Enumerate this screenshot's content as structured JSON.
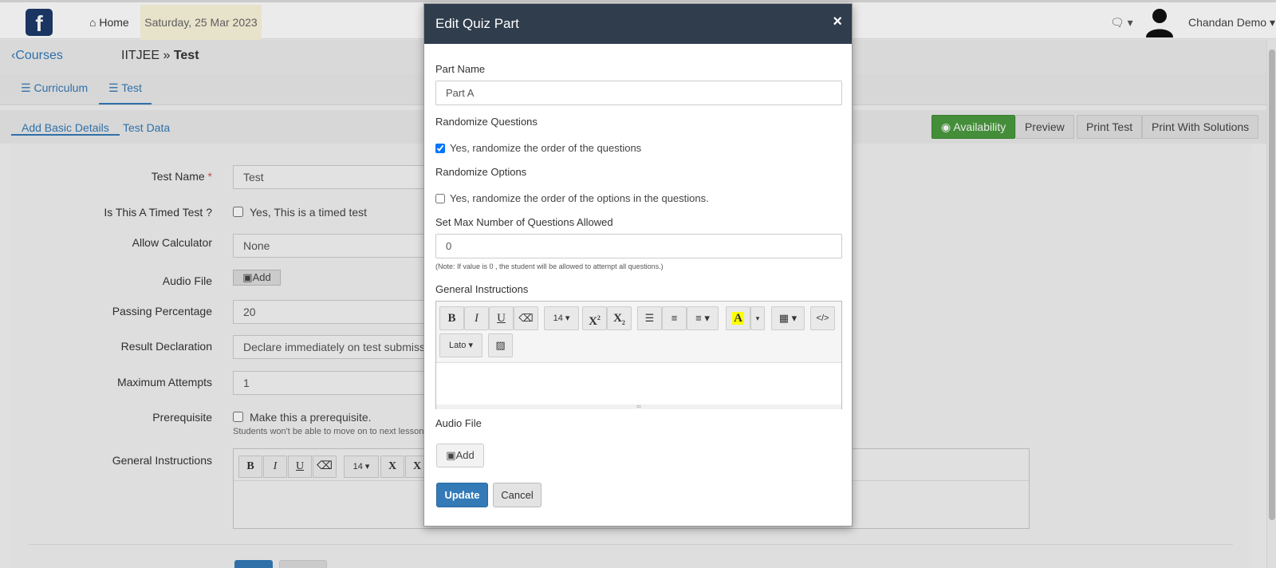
{
  "topbar": {
    "logo_letter": "f",
    "home_label": "Home",
    "date": "Saturday, 25 Mar 2023",
    "user_name": "Chandan Demo"
  },
  "breadcrumb": {
    "back_label": "Courses",
    "course": "IITJEE",
    "separator": " » ",
    "current": "Test"
  },
  "tabs": [
    {
      "label": "Curriculum",
      "active": false
    },
    {
      "label": "Test",
      "active": true
    }
  ],
  "subtabs": [
    {
      "label": "Add Basic Details",
      "active": true
    },
    {
      "label": "Test Data",
      "active": false
    }
  ],
  "actions": {
    "availability": "Availability",
    "preview": "Preview",
    "print_test": "Print Test",
    "print_solutions": "Print With Solutions"
  },
  "form": {
    "test_name_label": "Test Name",
    "test_name_value": "Test",
    "timed_label": "Is This A Timed Test ?",
    "timed_check": "Yes, This is a timed test",
    "calculator_label": "Allow Calculator",
    "calculator_value": "None",
    "audio_label": "Audio File",
    "audio_add": "Add",
    "passing_label": "Passing Percentage",
    "passing_value": "20",
    "result_label": "Result Declaration",
    "result_value": "Declare immediately on test submission",
    "attempts_label": "Maximum Attempts",
    "attempts_value": "1",
    "prereq_label": "Prerequisite",
    "prereq_check": "Make this a prerequisite.",
    "prereq_note": "Students won't be able to move on to next lessons u",
    "instructions_label": "General Instructions",
    "editor_size": "14"
  },
  "modal": {
    "title": "Edit Quiz Part",
    "close": "×",
    "part_name_label": "Part Name",
    "part_name_value": "Part A",
    "randomize_q_label": "Randomize Questions",
    "randomize_q_check": "Yes, randomize the order of the questions",
    "randomize_q_checked": true,
    "randomize_o_label": "Randomize Options",
    "randomize_o_check": "Yes, randomize the order of the options in the questions.",
    "randomize_o_checked": false,
    "max_q_label": "Set Max Number of Questions Allowed",
    "max_q_value": "0",
    "max_q_note": "(Note: If value is 0 , the student will be allowed to attempt all questions.)",
    "instructions_label": "General Instructions",
    "editor": {
      "bold": "B",
      "italic": "I",
      "underline": "U",
      "font_size": "14",
      "superscript": "X",
      "subscript": "X",
      "highlight": "A",
      "code": "</>",
      "font_family": "Lato"
    },
    "audio_label": "Audio File",
    "audio_add": "Add",
    "update_label": "Update",
    "cancel_label": "Cancel"
  },
  "colors": {
    "header_bg": "#2f3d4c",
    "primary": "#337ab7",
    "success": "#4a9b3f",
    "date_bg": "#fbf6dc"
  }
}
